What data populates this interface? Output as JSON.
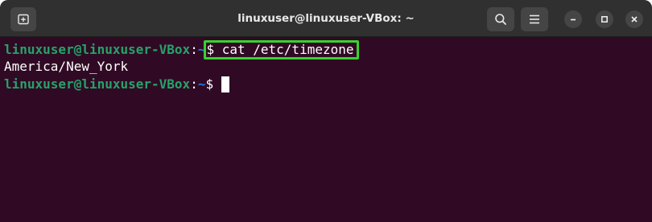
{
  "window": {
    "title": "linuxuser@linuxuser-VBox: ~"
  },
  "titlebar": {
    "buttons": [
      {
        "name": "new-tab",
        "icon": "new-tab-icon"
      },
      {
        "name": "search",
        "icon": "search-icon"
      },
      {
        "name": "menu",
        "icon": "hamburger-menu-icon"
      },
      {
        "name": "minimize",
        "icon": "minimize-icon"
      },
      {
        "name": "maximize",
        "icon": "maximize-icon"
      },
      {
        "name": "close",
        "icon": "close-icon"
      }
    ]
  },
  "terminal": {
    "line1": {
      "user_host": "linuxuser@linuxuser-VBox",
      "colon": ":",
      "path": "~",
      "dollar_command": "$ cat /etc/timezone"
    },
    "line2": {
      "output": "America/New_York"
    },
    "line3": {
      "user_host": "linuxuser@linuxuser-VBox",
      "colon": ":",
      "path": "~",
      "dollar": "$ "
    }
  },
  "colors": {
    "terminal_background": "#300a24",
    "prompt_user": "#26a269",
    "prompt_path": "#2a7bde",
    "highlight_box": "#36d32e",
    "titlebar": "#303030"
  }
}
